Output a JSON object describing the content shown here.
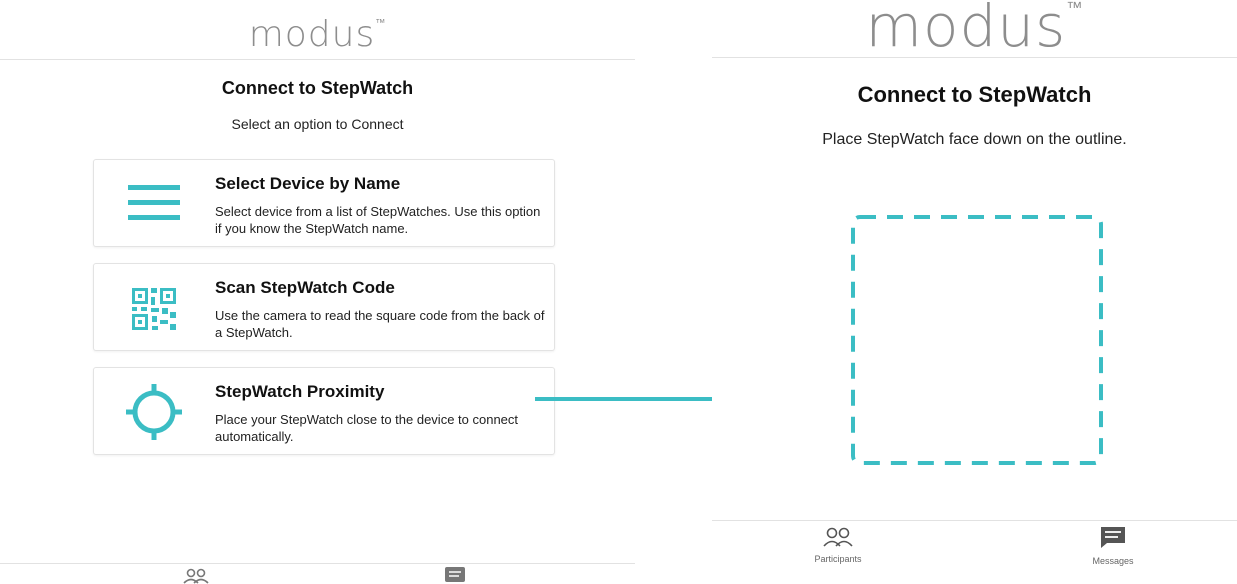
{
  "colors": {
    "accent": "#3bbdc4",
    "brand": "#8d8d8d",
    "divider": "#e2e2e2"
  },
  "left": {
    "brand": "modus",
    "trademark": "™",
    "title": "Connect to StepWatch",
    "subtitle": "Select an option to Connect",
    "options": [
      {
        "icon": "menu-lines-icon",
        "title": "Select Device by Name",
        "description": "Select device from a list of StepWatches. Use this option if you know the StepWatch name."
      },
      {
        "icon": "qr-code-icon",
        "title": "Scan StepWatch Code",
        "description": "Use the camera to read the square code from the back of a StepWatch."
      },
      {
        "icon": "crosshair-icon",
        "title": "StepWatch Proximity",
        "description": "Place your StepWatch close to the device to connect automatically."
      }
    ],
    "nav": [
      {
        "icon": "participants-icon"
      },
      {
        "icon": "messages-icon"
      }
    ]
  },
  "right": {
    "brand": "modus",
    "trademark": "™",
    "title": "Connect to StepWatch",
    "instruction": "Place StepWatch face down on the outline.",
    "outline_icon": "dashed-outline-square",
    "nav": [
      {
        "icon": "participants-icon",
        "label": "Participants"
      },
      {
        "icon": "messages-icon",
        "label": "Messages"
      }
    ]
  },
  "connector": {
    "icon": "arrow-right-icon"
  }
}
